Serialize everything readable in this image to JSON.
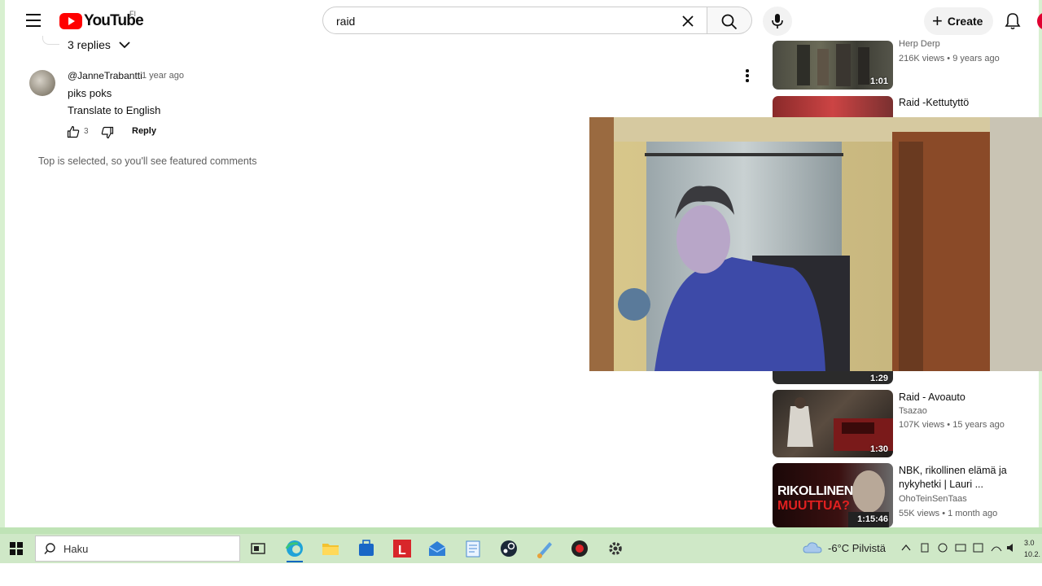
{
  "header": {
    "logo_text": "YouTube",
    "country_code": "FI",
    "search_value": "raid",
    "search_placeholder": "Search",
    "create_label": "Create"
  },
  "comments": {
    "replies_toggle": "3 replies",
    "comment": {
      "author": "@JanneTrabantti",
      "time": "1 year ago",
      "text": "piks poks",
      "translate": "Translate to English",
      "likes": "3",
      "reply_label": "Reply"
    },
    "featured_note": "Top is selected, so you'll see featured comments"
  },
  "related": [
    {
      "title": "",
      "channel": "Herp Derp",
      "meta": "216K views • 9 years ago",
      "duration": "1:01"
    },
    {
      "title": "Raid  -Kettutyttö",
      "channel": "",
      "meta": "",
      "duration": ""
    },
    {
      "title": "",
      "channel": "",
      "meta": "",
      "duration": "1:29"
    },
    {
      "title": "Raid - Avoauto",
      "channel": "Tsazao",
      "meta": "107K views • 15 years ago",
      "duration": "1:30"
    },
    {
      "title": "NBK, rikollinen elämä ja nykyhetki | Lauri ...",
      "channel": "OhoTeinSenTaas",
      "meta": "55K views • 1 month ago",
      "duration": "1:15:46",
      "thumb_text": "RIKOLLINEN",
      "thumb_text2": "MUUTTUA?"
    }
  ],
  "taskbar": {
    "search_label": "Haku",
    "weather": "-6°C Pilvistä",
    "clock_time": "3.0",
    "clock_date": "10.2."
  },
  "colors": {
    "youtube_red": "#ff0000",
    "taskbar_bg": "#cfe8c7",
    "accent_blue": "#0067c0"
  }
}
